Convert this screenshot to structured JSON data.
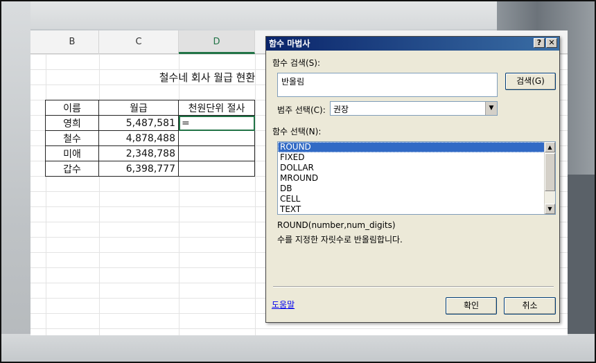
{
  "sheet": {
    "columns": [
      "B",
      "C",
      "D"
    ],
    "active_column": "D",
    "title": "철수네 회사 월급 현환",
    "table": {
      "headers": [
        "이름",
        "월급",
        "천원단위 절사"
      ],
      "rows": [
        {
          "name": "영희",
          "salary": "5,487,581",
          "rounded": "="
        },
        {
          "name": "철수",
          "salary": "4,878,488",
          "rounded": ""
        },
        {
          "name": "미애",
          "salary": "2,348,788",
          "rounded": ""
        },
        {
          "name": "갑수",
          "salary": "6,398,777",
          "rounded": ""
        }
      ]
    }
  },
  "dialog": {
    "title": "함수 마법사",
    "help_btn": "?",
    "close_btn": "✕",
    "search_label": "함수 검색(S):",
    "search_value": "반올림",
    "search_button": "검색(G)",
    "category_label": "범주 선택(C):",
    "category_value": "권장",
    "function_label": "함수 선택(N):",
    "functions": [
      "ROUND",
      "FIXED",
      "DOLLAR",
      "MROUND",
      "DB",
      "CELL",
      "TEXT"
    ],
    "selected_function": "ROUND",
    "syntax": "ROUND(number,num_digits)",
    "description": "수를 지정한 자릿수로 반올림합니다.",
    "help_link": "도움말",
    "ok_button": "확인",
    "cancel_button": "취소"
  },
  "colors": {
    "titlebar": "#0a246a",
    "selection": "#316ac5",
    "excel_green": "#217346"
  }
}
